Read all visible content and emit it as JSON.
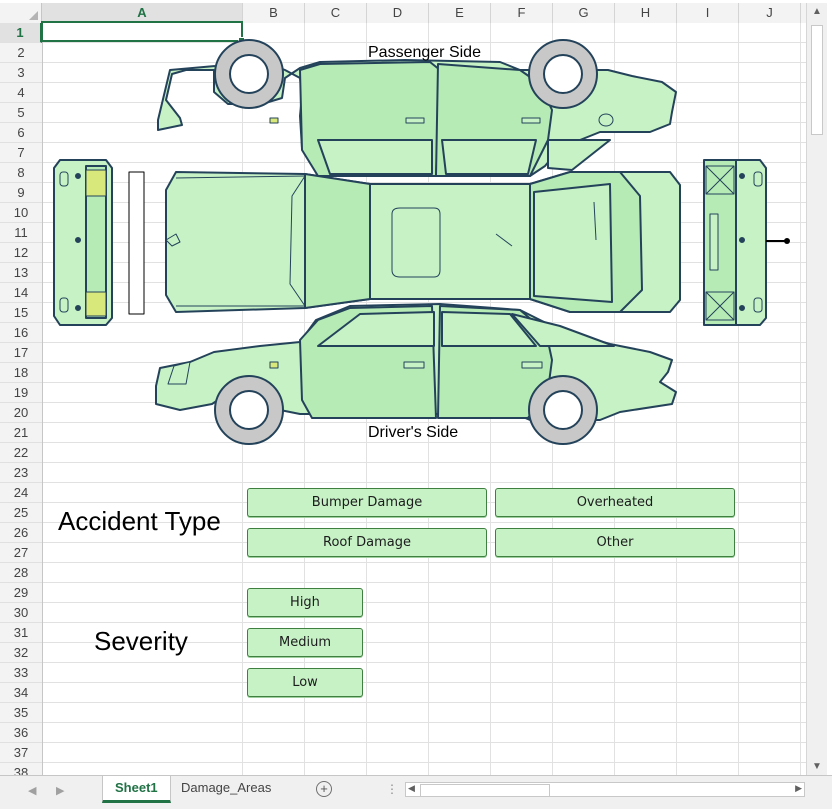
{
  "sheet": {
    "columns": [
      "A",
      "B",
      "C",
      "D",
      "E",
      "F",
      "G",
      "H",
      "I",
      "J"
    ],
    "selected_column": "A",
    "rows": [
      "1",
      "2",
      "3",
      "4",
      "5",
      "6",
      "7",
      "8",
      "9",
      "10",
      "11",
      "12",
      "13",
      "14",
      "15",
      "16",
      "17",
      "18",
      "19",
      "20",
      "21",
      "22",
      "23",
      "24",
      "25",
      "26",
      "27",
      "28",
      "29",
      "30",
      "31",
      "32",
      "33",
      "34",
      "35",
      "36",
      "37",
      "38"
    ],
    "selected_row": "1"
  },
  "diagram": {
    "passenger_label": "Passenger Side",
    "driver_label": "Driver's Side",
    "body_fill": "#c6f2c6",
    "outline_color": "#24435a",
    "wheel_fill": "#c8c8c8"
  },
  "accident": {
    "heading": "Accident Type",
    "buttons": [
      "Bumper Damage",
      "Overheated",
      "Roof Damage",
      "Other"
    ]
  },
  "severity": {
    "heading": "Severity",
    "buttons": [
      "High",
      "Medium",
      "Low"
    ]
  },
  "tabs": {
    "items": [
      "Sheet1",
      "Damage_Areas"
    ],
    "active": "Sheet1"
  },
  "colors": {
    "accent": "#217346",
    "button_fill": "#c6f2c6",
    "button_border": "#3f7f3f"
  }
}
